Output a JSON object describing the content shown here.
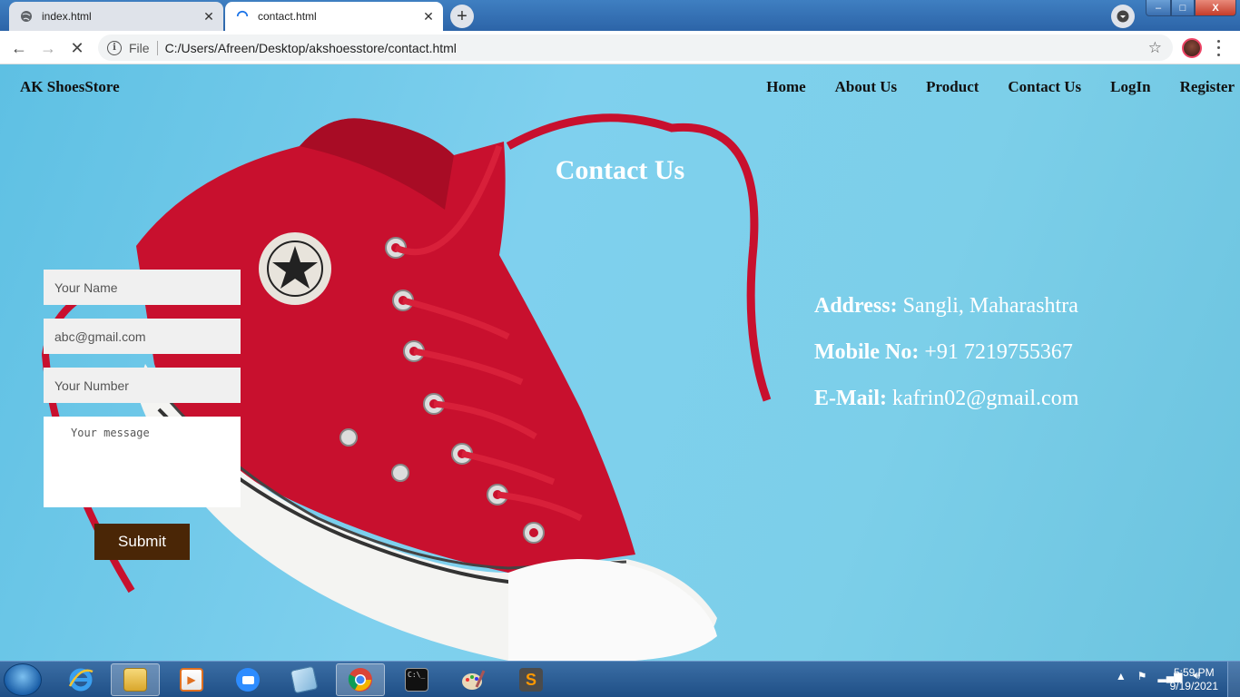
{
  "browser": {
    "tabs": [
      {
        "title": "index.html",
        "icon": "globe-icon",
        "active": false
      },
      {
        "title": "contact.html",
        "icon": "loading-spinner-icon",
        "active": true
      }
    ],
    "new_tab_label": "+",
    "address": {
      "scheme_label": "File",
      "url": "C:/Users/Afreen/Desktop/akshoesstore/contact.html"
    },
    "window_controls": {
      "minimize": "–",
      "maximize": "□",
      "close": "X"
    }
  },
  "site": {
    "brand": "AK ShoesStore",
    "nav": [
      "Home",
      "About Us",
      "Product",
      "Contact Us",
      "LogIn",
      "Register"
    ]
  },
  "contact": {
    "heading": "Contact Us",
    "form": {
      "name_placeholder": "Your Name",
      "email_value": "abc@gmail.com",
      "number_placeholder": "Your Number",
      "message_placeholder": "Your message",
      "submit_label": "Submit"
    },
    "info": {
      "address_label": "Address:",
      "address_value": "Sangli, Maharashtra",
      "mobile_label": "Mobile No:",
      "mobile_value": "+91 7219755367",
      "email_label": "E-Mail:",
      "email_value": "kafrin02@gmail.com"
    }
  },
  "taskbar": {
    "apps": [
      "internet-explorer-icon",
      "file-explorer-icon",
      "media-player-icon",
      "zoom-icon",
      "notepad-icon",
      "chrome-icon",
      "cmd-icon",
      "paint-icon",
      "sublime-text-icon"
    ],
    "clock_time": "5:59 PM",
    "clock_date": "9/19/2021"
  },
  "colors": {
    "submit_bg": "#4a2606",
    "page_bg": "#6fc8e6",
    "shoe_red": "#c8102e"
  }
}
